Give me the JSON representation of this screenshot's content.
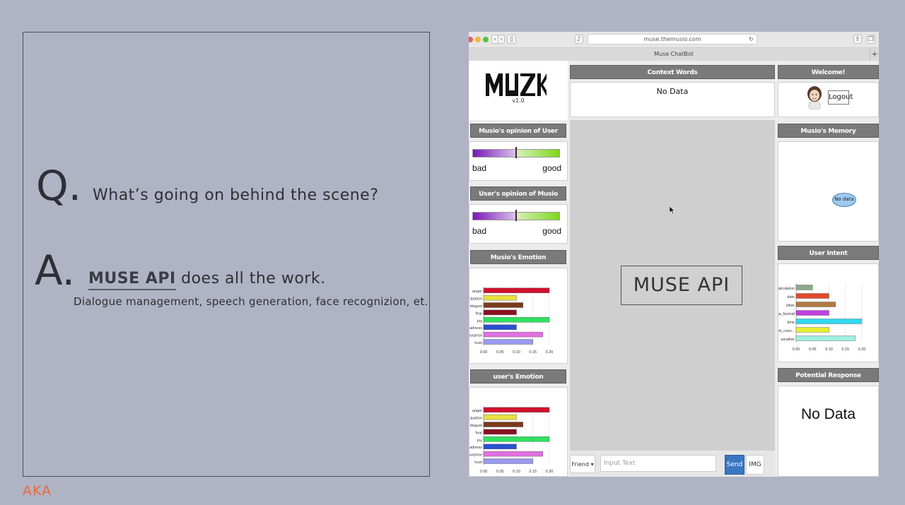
{
  "slide": {
    "q_letter": "Q.",
    "question": "What’s going on behind the scene?",
    "a_letter": "A.",
    "answer_highlight": "MUSE API",
    "answer_rest": " does all the work.",
    "answer_sub": "Dialogue management, speech generation,  face recognizion, et.",
    "brand": "AKA"
  },
  "browser": {
    "url": "muse.themusio.com",
    "tab_title": "Muse ChatBot",
    "new_tab": "+",
    "back": "‹",
    "forward": "›"
  },
  "app": {
    "logo_version": "v1.0",
    "context_words": {
      "title": "Context Words",
      "value": "No Data"
    },
    "welcome": {
      "title": "Welcome!",
      "logout": "Logout"
    },
    "opinion_of_user": {
      "title": "Musio's opinion of User",
      "bad": "bad",
      "good": "good",
      "level": 0.5
    },
    "opinion_of_musio": {
      "title": "User's opinion of Musio",
      "bad": "bad",
      "good": "good",
      "level": 0.5
    },
    "musio_emotion": {
      "title": "Musio's Emotion"
    },
    "user_emotion": {
      "title": "user's Emotion"
    },
    "memory": {
      "title": "Musio's Memory",
      "bubble": "No data"
    },
    "user_intent": {
      "title": "User Intent"
    },
    "potential_response": {
      "title": "Potential Response",
      "value": "No Data"
    },
    "center_label": "MUSE API",
    "input": {
      "dropdown": "Friend",
      "placeholder": "Input Text",
      "send": "Send",
      "img": "IMG"
    }
  },
  "chart_data": [
    {
      "type": "bar",
      "title": "Musio's Emotion",
      "categories": [
        "anger",
        "anticipation",
        "disgust",
        "fear",
        "joy",
        "sadness",
        "surprise",
        "trust"
      ],
      "values": [
        0.2,
        0.1,
        0.12,
        0.1,
        0.2,
        0.1,
        0.18,
        0.15
      ],
      "colors": [
        "#d0102c",
        "#e8e040",
        "#7a3a1e",
        "#8a1020",
        "#30e060",
        "#2a50d0",
        "#e070e0",
        "#9a9af0"
      ],
      "xticks": [
        "0.00",
        "0.05",
        "0.10",
        "0.15",
        "0.20"
      ],
      "xlim": [
        0,
        0.2
      ]
    },
    {
      "type": "bar",
      "title": "user's Emotion",
      "categories": [
        "anger",
        "anticipation",
        "disgust",
        "fear",
        "joy",
        "sadness",
        "surprise",
        "trust"
      ],
      "values": [
        0.2,
        0.1,
        0.12,
        0.1,
        0.2,
        0.1,
        0.18,
        0.15
      ],
      "colors": [
        "#d0102c",
        "#e8e040",
        "#7a3a1e",
        "#8a1020",
        "#30e060",
        "#2a50d0",
        "#e070e0",
        "#9a9af0"
      ],
      "xticks": [
        "0.00",
        "0.05",
        "0.10",
        "0.15",
        "0.20"
      ],
      "xlim": [
        0,
        0.2
      ]
    },
    {
      "type": "bar",
      "title": "User Intent",
      "categories": [
        "calculation",
        "date",
        "other",
        "qa_factoid",
        "time",
        "unit_conv...",
        "weather"
      ],
      "values": [
        0.05,
        0.1,
        0.12,
        0.1,
        0.2,
        0.1,
        0.18
      ],
      "colors": [
        "#8aaa8a",
        "#e04a2a",
        "#b07a40",
        "#c040e0",
        "#30d8f0",
        "#e8f030",
        "#a0f0e0"
      ],
      "xticks": [
        "0.00",
        "0.05",
        "0.10",
        "0.15",
        "0.20"
      ],
      "xlim": [
        0,
        0.2
      ]
    }
  ]
}
